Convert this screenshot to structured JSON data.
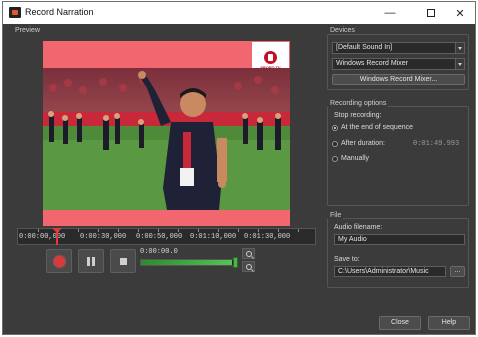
{
  "window": {
    "title": "Record Narration"
  },
  "preview": {
    "group_label": "Preview",
    "logo_text": "SPORT·TV",
    "timeline_labels": [
      "0:00:00,000",
      "0:00:30,000",
      "0:00:50,000",
      "0:01:10,000",
      "0:01:30,000"
    ],
    "rec_time": "0:00:00.0",
    "level": 0.97
  },
  "devices": {
    "group_label": "Devices",
    "input_device": "[Default Sound In]",
    "mixer": "Windows Record Mixer",
    "mixer_button": "Windows Record Mixer..."
  },
  "recording_options": {
    "group_label": "Recording options",
    "stop_label": "Stop recording:",
    "options": [
      "At the end of sequence",
      "After duration:",
      "Manually"
    ],
    "selected": "At the end of sequence",
    "duration_value": "0:01:49.993"
  },
  "file": {
    "group_label": "File",
    "filename_label": "Audio filename:",
    "filename": "My Audio",
    "save_label": "Save to:",
    "save_path": "C:\\Users\\Administrator\\Music",
    "browse": "..."
  },
  "footer": {
    "close": "Close",
    "help": "Help"
  },
  "colors": {
    "accent_red": "#d83a3a",
    "banner_pink": "#f26670",
    "level_green": "#46b846"
  }
}
